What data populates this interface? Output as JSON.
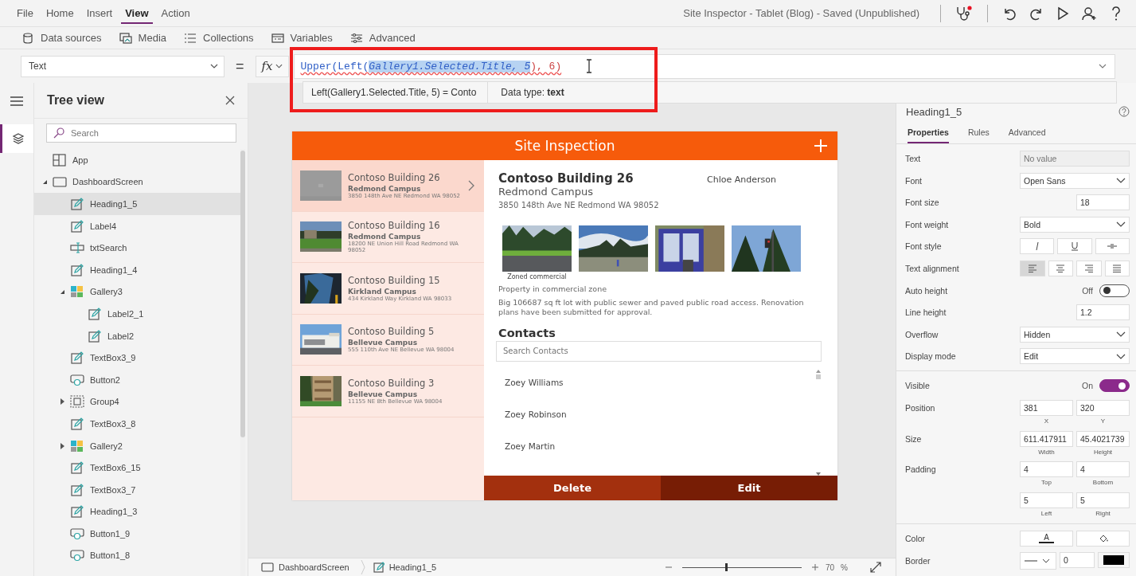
{
  "menu": [
    {
      "label": "File",
      "selected": false
    },
    {
      "label": "Home",
      "selected": false
    },
    {
      "label": "Insert",
      "selected": false
    },
    {
      "label": "View",
      "selected": true
    },
    {
      "label": "Action",
      "selected": false
    }
  ],
  "document_title": "Site Inspector - Tablet (Blog) - Saved (Unpublished)",
  "toolbar": [
    "Data sources",
    "Media",
    "Collections",
    "Variables",
    "Advanced"
  ],
  "formula_bar": {
    "property": "Text",
    "equals": "=",
    "fx": "fx",
    "highlighted": true,
    "formula": [
      {
        "text": "Upper(Left",
        "selected": false
      },
      {
        "text": "(",
        "selected": false
      },
      {
        "text": "Gallery1.Selected.Title, 5",
        "selected": true
      },
      {
        "text": "), 6)",
        "selected": false
      }
    ],
    "result": "Left(Gallery1.Selected.Title, 5)  =  Conto",
    "data_type": "Data type: **text**"
  },
  "tree": {
    "title": "Tree view",
    "search_placeholder": "Search",
    "items": [
      {
        "label": "App",
        "kind": "app",
        "selected": false
      },
      {
        "label": "DashboardScreen",
        "kind": "screen",
        "selected": false,
        "expanded": true,
        "children": [
          {
            "label": "Heading1_5",
            "kind": "label",
            "selected": true
          },
          {
            "label": "Label4",
            "kind": "label",
            "selected": false
          },
          {
            "label": "txtSearch",
            "kind": "input",
            "selected": false
          },
          {
            "label": "Heading1_4",
            "kind": "label",
            "selected": false
          },
          {
            "label": "Gallery3",
            "kind": "gallery",
            "selected": false,
            "expanded": true,
            "children": [
              {
                "label": "Label2_1",
                "kind": "label",
                "selected": false
              },
              {
                "label": "Label2",
                "kind": "label",
                "selected": false
              }
            ]
          },
          {
            "label": "TextBox3_9",
            "kind": "label",
            "selected": false
          },
          {
            "label": "Button2",
            "kind": "button",
            "selected": false
          },
          {
            "label": "Group4",
            "kind": "group",
            "selected": false,
            "expanded": false
          },
          {
            "label": "TextBox3_8",
            "kind": "label",
            "selected": false
          },
          {
            "label": "Gallery2",
            "kind": "gallery",
            "selected": false,
            "expanded": false
          },
          {
            "label": "TextBox6_15",
            "kind": "label",
            "selected": false
          },
          {
            "label": "TextBox3_7",
            "kind": "label",
            "selected": false
          },
          {
            "label": "Heading1_3",
            "kind": "label",
            "selected": false
          },
          {
            "label": "Button1_9",
            "kind": "button",
            "selected": false
          },
          {
            "label": "Button1_8",
            "kind": "button",
            "selected": false
          }
        ]
      }
    ]
  },
  "app": {
    "title": "Site Inspection",
    "gallery": [
      {
        "title": "Contoso Building 26",
        "campus": "Redmond Campus",
        "address": "3850 148th Ave NE Redmond WA 98052",
        "selected": true
      },
      {
        "title": "Contoso Building 16",
        "campus": "Redmond Campus",
        "address": "18200 NE Union Hill Road Redmond WA 98052",
        "selected": false
      },
      {
        "title": "Contoso Building 15",
        "campus": "Kirkland Campus",
        "address": "434 Kirkland Way Kirkland WA 98033",
        "selected": false
      },
      {
        "title": "Contoso Building 5",
        "campus": "Bellevue Campus",
        "address": "555 110th Ave NE Bellevue WA 98004",
        "selected": false
      },
      {
        "title": "Contoso Building 3",
        "campus": "Bellevue Campus",
        "address": "11155 NE 8th Bellevue WA 98004",
        "selected": false
      }
    ],
    "detail": {
      "title": "Contoso Building 26",
      "owner": "Chloe Anderson",
      "campus": "Redmond Campus",
      "address": "3850 148th Ave NE Redmond WA 98052",
      "photos": [
        {
          "kind": "picture",
          "caption": "Zoned commercial"
        },
        {
          "kind": "picture"
        },
        {
          "kind": "picture"
        },
        {
          "kind": "picture"
        }
      ],
      "zone": "Property in commercial zone",
      "description": "Big 106687 sq ft lot with public sewer and paved public road access. Renovation plans have been submitted for approval.",
      "contacts_title": "Contacts",
      "contacts_placeholder": "Search Contacts",
      "contacts": [
        "Zoey Williams",
        "Zoey Robinson",
        "Zoey Martin"
      ]
    },
    "buttons": [
      "Delete",
      "Edit"
    ]
  },
  "properties": {
    "control": "Heading1_5",
    "tabs": [
      {
        "label": "Properties",
        "selected": true
      },
      {
        "label": "Rules",
        "selected": false
      },
      {
        "label": "Advanced",
        "selected": false
      }
    ],
    "sections": [
      [
        {
          "kind": "text",
          "label": "Text",
          "placeholder": "No value"
        },
        {
          "kind": "dropdown",
          "label": "Font",
          "value": "Open Sans"
        },
        {
          "kind": "number",
          "label": "Font size",
          "value": "18"
        },
        {
          "kind": "dropdown",
          "label": "Font weight",
          "value": "Bold"
        },
        {
          "kind": "style",
          "label": "Font style",
          "options": [
            {
              "selected": false
            },
            {
              "selected": false
            },
            {
              "selected": false
            }
          ]
        },
        {
          "kind": "align",
          "label": "Text alignment",
          "options": [
            {
              "selected": true
            },
            {
              "selected": false
            },
            {
              "selected": false
            },
            {
              "selected": false
            }
          ]
        },
        {
          "kind": "toggle",
          "label": "Auto height",
          "state": "Off",
          "on": false
        },
        {
          "kind": "number",
          "label": "Line height",
          "value": "1.2"
        },
        {
          "kind": "dropdown",
          "label": "Overflow",
          "value": "Hidden"
        },
        {
          "kind": "dropdown",
          "label": "Display mode",
          "value": "Edit"
        }
      ],
      [
        {
          "kind": "toggle",
          "label": "Visible",
          "state": "On",
          "on": true
        },
        {
          "kind": "pair",
          "label": "Position",
          "values": [
            "381",
            "320"
          ],
          "captions": [
            "X",
            "Y"
          ]
        },
        {
          "kind": "pair",
          "label": "Size",
          "values": [
            "611.417911",
            "45.4021739"
          ],
          "captions": [
            "Width",
            "Height"
          ]
        },
        {
          "kind": "pair",
          "label": "Padding",
          "values": [
            "4",
            "4"
          ],
          "captions": [
            "Top",
            "Bottom"
          ]
        },
        {
          "kind": "pair",
          "values": [
            "5",
            "5"
          ],
          "captions": [
            "Left",
            "Right"
          ]
        }
      ],
      [
        {
          "kind": "color",
          "label": "Color",
          "text": "A"
        },
        {
          "kind": "border",
          "label": "Border",
          "value": "0"
        }
      ]
    ]
  },
  "status_bar": {
    "breadcrumbs": [
      {
        "kind": "screen",
        "label": "DashboardScreen"
      },
      {
        "kind": "label",
        "label": "Heading1_5"
      }
    ],
    "zoom": {
      "level": 0.37,
      "value": "70",
      "unit": "%"
    }
  }
}
